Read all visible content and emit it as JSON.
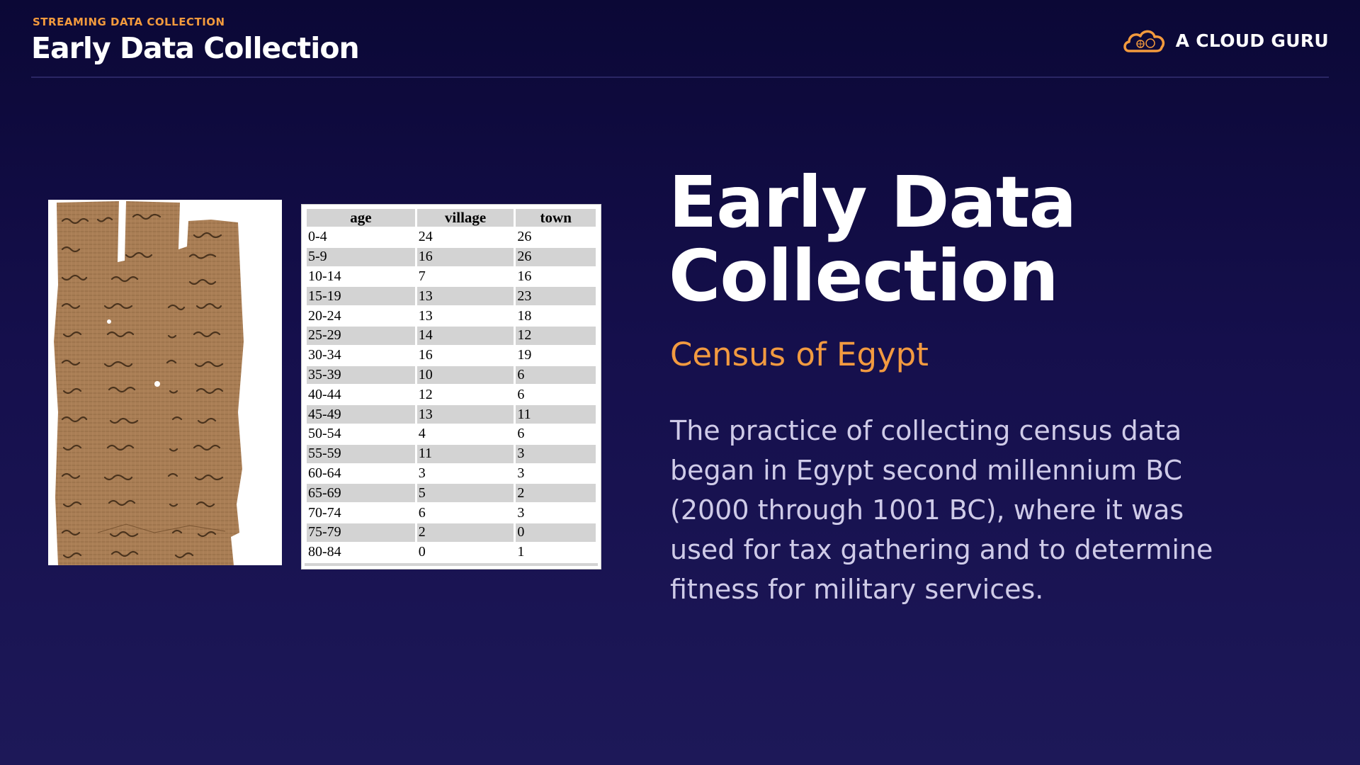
{
  "header": {
    "eyebrow": "STREAMING DATA COLLECTION",
    "title": "Early Data Collection",
    "brand": "A CLOUD GURU"
  },
  "images": {
    "papyrus": "papyrus-manuscript-image"
  },
  "census_table": {
    "columns": [
      "age",
      "village",
      "town"
    ],
    "rows": [
      [
        "0-4",
        "24",
        "26"
      ],
      [
        "5-9",
        "16",
        "26"
      ],
      [
        "10-14",
        "7",
        "16"
      ],
      [
        "15-19",
        "13",
        "23"
      ],
      [
        "20-24",
        "13",
        "18"
      ],
      [
        "25-29",
        "14",
        "12"
      ],
      [
        "30-34",
        "16",
        "19"
      ],
      [
        "35-39",
        "10",
        "6"
      ],
      [
        "40-44",
        "12",
        "6"
      ],
      [
        "45-49",
        "13",
        "11"
      ],
      [
        "50-54",
        "4",
        "6"
      ],
      [
        "55-59",
        "11",
        "3"
      ],
      [
        "60-64",
        "3",
        "3"
      ],
      [
        "65-69",
        "5",
        "2"
      ],
      [
        "70-74",
        "6",
        "3"
      ],
      [
        "75-79",
        "2",
        "0"
      ],
      [
        "80-84",
        "0",
        "1"
      ]
    ]
  },
  "main": {
    "title_line1": "Early Data",
    "title_line2": "Collection",
    "subtitle": "Census of Egypt",
    "body": "The practice of collecting census data began in Egypt second millennium BC (2000 through 1001 BC), where it was used for tax gathering and to determine fitness for military services."
  },
  "colors": {
    "accent": "#f39a3d",
    "background": "#150f4c",
    "body_text": "#cfcbe8"
  }
}
